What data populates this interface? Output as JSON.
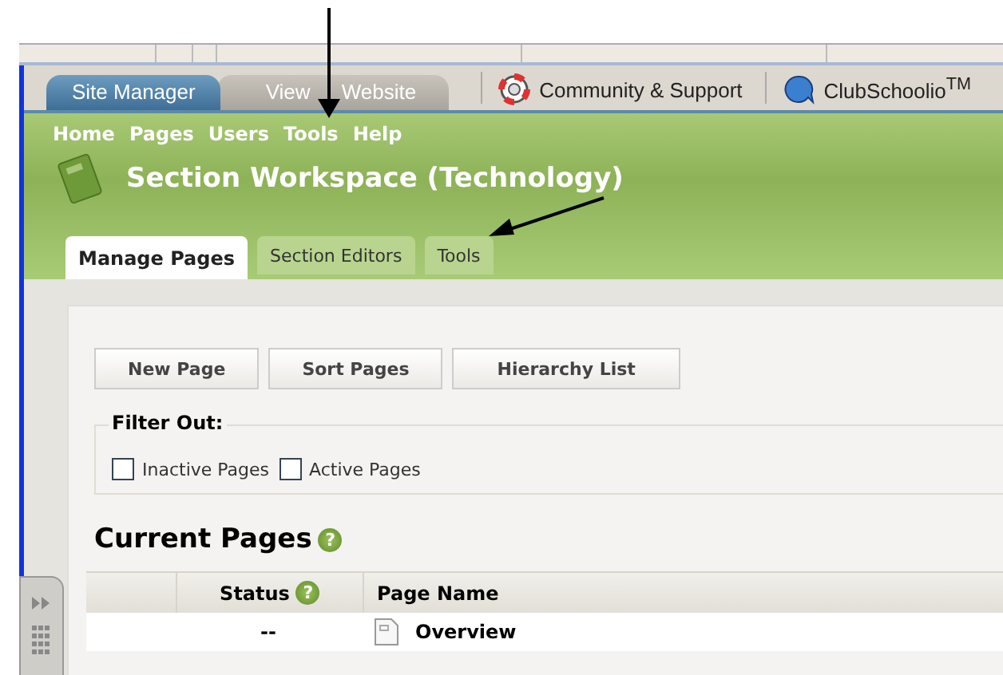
{
  "app_tabs": [
    {
      "label": "Site Manager",
      "selected": true
    },
    {
      "label": "View Website",
      "selected": false
    }
  ],
  "top_links": [
    {
      "label": "Community & Support",
      "kind": "lifebuoy"
    },
    {
      "label": "ClubSchoolio$^{TM}$",
      "kind": "bubble"
    }
  ],
  "nav": [
    "Home",
    "Pages",
    "Users",
    "Tools",
    "Help"
  ],
  "title": "Section Workspace (Technology)",
  "section_tabs": [
    {
      "label": "Manage Pages",
      "selected": true
    },
    {
      "label": "Section Editors",
      "selected": false
    },
    {
      "label": "Tools",
      "selected": false
    }
  ],
  "buttons": [
    "New Page",
    "Sort Pages",
    "Hierarchy List"
  ],
  "filter": {
    "legend": "Filter Out:",
    "options": [
      {
        "label": "Inactive Pages",
        "checked": false
      },
      {
        "label": "Active Pages",
        "checked": false
      }
    ]
  },
  "current_pages": {
    "heading": "Current Pages",
    "heading_help": "?",
    "columns": [
      {},
      {
        "label": "Status",
        "help": "?"
      },
      {
        "label": "Page Name"
      }
    ],
    "rows": [
      {
        "status": "--",
        "name": "Overview"
      }
    ]
  }
}
